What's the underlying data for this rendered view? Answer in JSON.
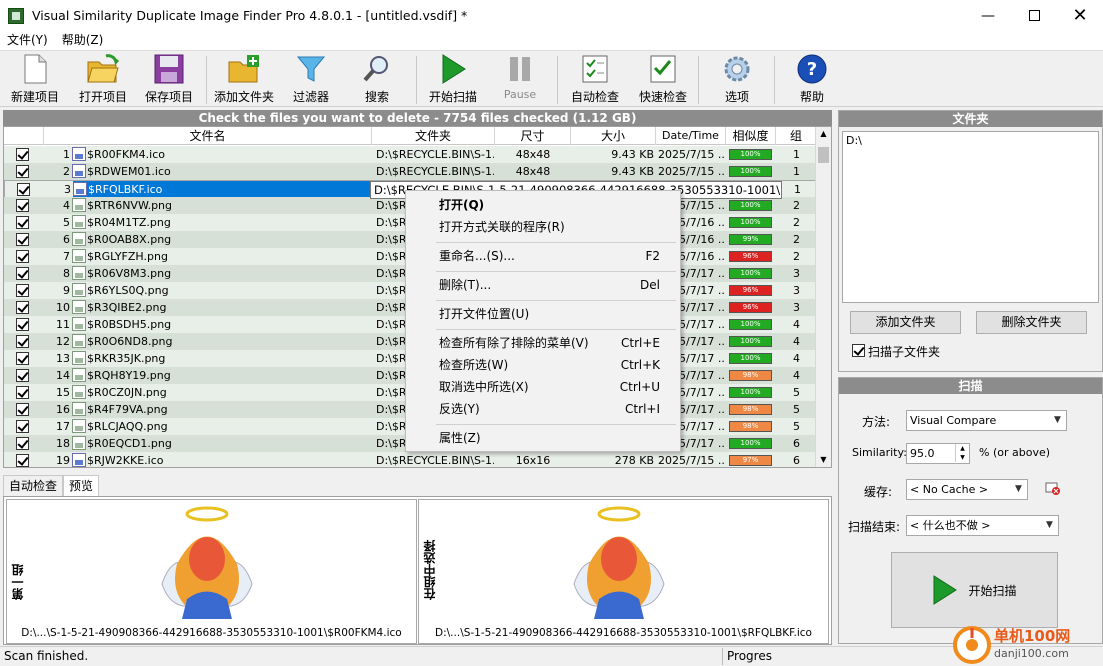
{
  "window": {
    "title": "Visual Similarity Duplicate Image Finder Pro 4.8.0.1 - [untitled.vsdif] *",
    "min_icon": "minimize-icon",
    "max_icon": "maximize-icon",
    "close_icon": "close-icon"
  },
  "menu": [
    "文件(Y)",
    "帮助(Z)"
  ],
  "toolbar": [
    {
      "label": "新建项目",
      "icon": "new-document-icon"
    },
    {
      "label": "打开项目",
      "icon": "open-folder-icon"
    },
    {
      "label": "保存项目",
      "icon": "floppy-disk-icon"
    },
    {
      "label": "添加文件夹",
      "icon": "add-folder-icon"
    },
    {
      "label": "过滤器",
      "icon": "funnel-icon"
    },
    {
      "label": "搜索",
      "icon": "magnifier-icon"
    },
    {
      "label": "开始扫描",
      "icon": "play-icon"
    },
    {
      "label": "Pause",
      "icon": "pause-icon",
      "disabled": true
    },
    {
      "label": "自动检查",
      "icon": "auto-check-icon"
    },
    {
      "label": "快速检查",
      "icon": "quick-check-icon"
    },
    {
      "label": "选项",
      "icon": "gear-icon"
    },
    {
      "label": "帮助",
      "icon": "help-icon"
    }
  ],
  "results": {
    "header": "Check the files you want to delete - 7754 files checked (1.12 GB)",
    "columns": [
      "文件名",
      "文件夹",
      "尺寸",
      "大小",
      "Date/Time",
      "相似度",
      "组"
    ],
    "rows": [
      {
        "n": "1",
        "name": "$R00FKM4.ico",
        "folder": "D:\\$RECYCLE.BIN\\S-1...",
        "dim": "48x48",
        "size": "9.43 KB",
        "date": "2025/7/15 ...",
        "sim": "100%",
        "grp": "1",
        "ext": "ico",
        "simc": "#22aa22"
      },
      {
        "n": "2",
        "name": "$RDWEM01.ico",
        "folder": "D:\\$RECYCLE.BIN\\S-1...",
        "dim": "48x48",
        "size": "9.43 KB",
        "date": "2025/7/15 ...",
        "sim": "100%",
        "grp": "1",
        "ext": "ico",
        "simc": "#22aa22"
      },
      {
        "n": "3",
        "name": "$RFQLBKF.ico",
        "folder": "D:\\$RE",
        "dim": "",
        "size": "",
        "date": "",
        "sim": "",
        "grp": "1",
        "ext": "ico",
        "simc": "#22aa22"
      },
      {
        "n": "4",
        "name": "$RTR6NVW.png",
        "folder": "D:\\$RE",
        "dim": "",
        "size": "",
        "date": "2025/7/15 ...",
        "sim": "100%",
        "grp": "2",
        "ext": "png",
        "simc": "#22aa22"
      },
      {
        "n": "5",
        "name": "$R04M1TZ.png",
        "folder": "D:\\$RE",
        "dim": "",
        "size": "",
        "date": "2025/7/16 ...",
        "sim": "100%",
        "grp": "2",
        "ext": "png",
        "simc": "#22aa22"
      },
      {
        "n": "6",
        "name": "$R0OAB8X.png",
        "folder": "D:\\$RE",
        "dim": "",
        "size": "",
        "date": "2025/7/16 ...",
        "sim": "99%",
        "grp": "2",
        "ext": "png",
        "simc": "#22aa22"
      },
      {
        "n": "7",
        "name": "$RGLYFZH.png",
        "folder": "D:\\$RE",
        "dim": "",
        "size": "",
        "date": "2025/7/16 ...",
        "sim": "96%",
        "grp": "2",
        "ext": "png",
        "simc": "#dd2222"
      },
      {
        "n": "8",
        "name": "$R06V8M3.png",
        "folder": "D:\\$RE",
        "dim": "",
        "size": "",
        "date": "2025/7/17 ...",
        "sim": "100%",
        "grp": "3",
        "ext": "png",
        "simc": "#22aa22"
      },
      {
        "n": "9",
        "name": "$R6YLS0Q.png",
        "folder": "D:\\$RE",
        "dim": "",
        "size": "",
        "date": "2025/7/17 ...",
        "sim": "96%",
        "grp": "3",
        "ext": "png",
        "simc": "#dd2222"
      },
      {
        "n": "10",
        "name": "$R3QIBE2.png",
        "folder": "D:\\$RE",
        "dim": "",
        "size": "",
        "date": "2025/7/17 ...",
        "sim": "96%",
        "grp": "3",
        "ext": "png",
        "simc": "#dd2222"
      },
      {
        "n": "11",
        "name": "$R0BSDH5.png",
        "folder": "D:\\$RE",
        "dim": "",
        "size": "",
        "date": "2025/7/17 ...",
        "sim": "100%",
        "grp": "4",
        "ext": "png",
        "simc": "#22aa22"
      },
      {
        "n": "12",
        "name": "$R0O6ND8.png",
        "folder": "D:\\$RE",
        "dim": "",
        "size": "",
        "date": "2025/7/17 ...",
        "sim": "100%",
        "grp": "4",
        "ext": "png",
        "simc": "#22aa22"
      },
      {
        "n": "13",
        "name": "$RKR35JK.png",
        "folder": "D:\\$RE",
        "dim": "",
        "size": "",
        "date": "2025/7/17 ...",
        "sim": "100%",
        "grp": "4",
        "ext": "png",
        "simc": "#22aa22"
      },
      {
        "n": "14",
        "name": "$RQH8Y19.png",
        "folder": "D:\\$RE",
        "dim": "",
        "size": "",
        "date": "2025/7/17 ...",
        "sim": "98%",
        "grp": "4",
        "ext": "png",
        "simc": "#ee8844"
      },
      {
        "n": "15",
        "name": "$R0CZ0JN.png",
        "folder": "D:\\$RE",
        "dim": "",
        "size": "",
        "date": "2025/7/17 ...",
        "sim": "100%",
        "grp": "5",
        "ext": "png",
        "simc": "#22aa22"
      },
      {
        "n": "16",
        "name": "$R4F79VA.png",
        "folder": "D:\\$RE",
        "dim": "",
        "size": "",
        "date": "2025/7/17 ...",
        "sim": "98%",
        "grp": "5",
        "ext": "png",
        "simc": "#ee8844"
      },
      {
        "n": "17",
        "name": "$RLCJAQQ.png",
        "folder": "D:\\$RE",
        "dim": "",
        "size": "",
        "date": "2025/7/17 ...",
        "sim": "98%",
        "grp": "5",
        "ext": "png",
        "simc": "#ee8844"
      },
      {
        "n": "18",
        "name": "$R0EQCD1.png",
        "folder": "D:\\$RE",
        "dim": "",
        "size": "",
        "date": "2025/7/17 ...",
        "sim": "100%",
        "grp": "6",
        "ext": "png",
        "simc": "#22aa22"
      },
      {
        "n": "19",
        "name": "$RJW2KKE.ico",
        "folder": "D:\\$RECYCLE.BIN\\S-1...",
        "dim": "16x16",
        "size": "278 KB",
        "date": "2025/7/15 ...",
        "sim": "97%",
        "grp": "6",
        "ext": "ico",
        "simc": "#ee8844"
      }
    ],
    "tooltip": "D:\\$RECYCLE.BIN\\S-1-5-21-490908366-442916688-3530553310-1001\\"
  },
  "context_menu": [
    {
      "label": "打开(Q)",
      "key": "",
      "bold": true
    },
    {
      "label": "打开方式关联的程序(R)",
      "key": ""
    },
    {
      "label": "重命名...(S)...",
      "key": "F2"
    },
    {
      "label": "删除(T)...",
      "key": "Del"
    },
    {
      "label": "打开文件位置(U)",
      "key": ""
    },
    {
      "label": "检查所有除了排除的菜单(V)",
      "key": "Ctrl+E"
    },
    {
      "label": "检查所选(W)",
      "key": "Ctrl+K"
    },
    {
      "label": "取消选中所选(X)",
      "key": "Ctrl+U"
    },
    {
      "label": "反选(Y)",
      "key": "Ctrl+I"
    },
    {
      "label": "属性(Z)",
      "key": ""
    }
  ],
  "bottom_tabs": [
    "自动检查",
    "预览"
  ],
  "preview": {
    "left_label": "第一组",
    "right_label": "在组中选择",
    "left_path": "D:\\...\\S-1-5-21-490908366-442916688-3530553310-1001\\$R00FKM4.ico",
    "right_path": "D:\\...\\S-1-5-21-490908366-442916688-3530553310-1001\\$RFQLBKF.ico"
  },
  "folders": {
    "title": "文件夹",
    "items": [
      "D:\\"
    ],
    "add_btn": "添加文件夹",
    "remove_btn": "删除文件夹",
    "scan_sub": "扫描子文件夹"
  },
  "scan": {
    "title": "扫描",
    "method_label": "方法:",
    "method_value": "Visual Compare",
    "similarity_label": "Similarity:",
    "similarity_value": "95.0",
    "similarity_suffix": "% (or above)",
    "cache_label": "缓存:",
    "cache_value": "< No Cache >",
    "end_label": "扫描结束:",
    "end_value": "< 什么也不做 >",
    "start_btn": "开始扫描"
  },
  "status": {
    "left": "Scan finished.",
    "right": "Progres"
  },
  "watermark": {
    "text": "单机100网",
    "url": "danji100.com"
  }
}
